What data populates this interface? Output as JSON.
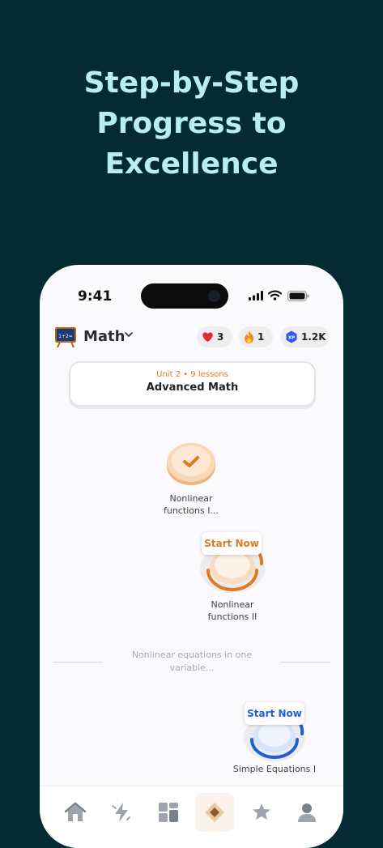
{
  "headline": {
    "line1": "Step-by-Step",
    "line2": "Progress to",
    "line3": "Excellence"
  },
  "status_bar": {
    "time": "9:41"
  },
  "header": {
    "subject": "Math",
    "board_text": "1+2=",
    "hearts": "3",
    "streak": "1",
    "xp_badge": "XP",
    "xp": "1.2K"
  },
  "unit": {
    "subtitle": "Unit 2 • 9 lessons",
    "title": "Advanced Math"
  },
  "path": {
    "lesson1": {
      "label_line1": "Nonlinear",
      "label_line2": "functions I...",
      "status": "completed"
    },
    "lesson2": {
      "label_line1": "Nonlinear",
      "label_line2": "functions II",
      "cta": "Start Now"
    },
    "section_divider": {
      "line1": "Nonlinear equations in one",
      "line2": "variable..."
    },
    "lesson3": {
      "label": "Simple Equations I",
      "cta": "Start Now"
    }
  },
  "tabs": [
    {
      "icon": "home-icon"
    },
    {
      "icon": "lightning-icon"
    },
    {
      "icon": "grid-icon"
    },
    {
      "icon": "diamond-icon",
      "active": true
    },
    {
      "icon": "star-icon"
    },
    {
      "icon": "profile-icon"
    }
  ],
  "colors": {
    "background": "#032B31",
    "headline": "#B9EEF0",
    "orange": "#E07A1F",
    "blue": "#1F5FD6"
  }
}
